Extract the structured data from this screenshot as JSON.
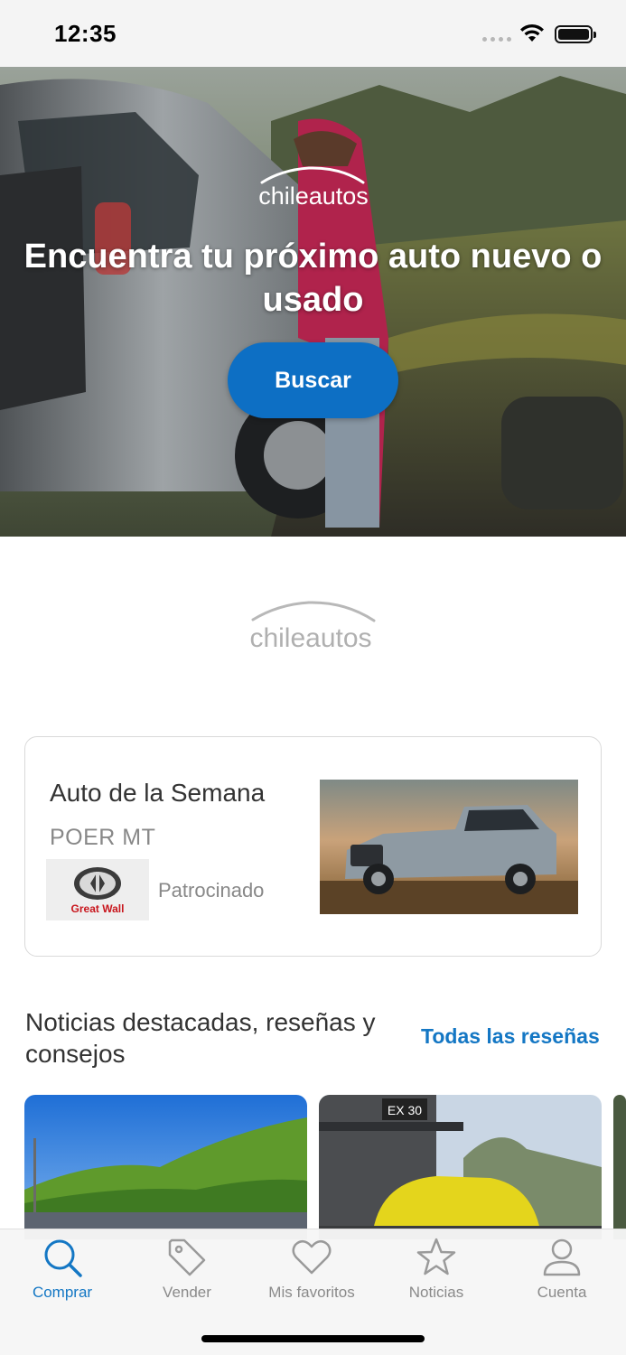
{
  "status_bar": {
    "time": "12:35"
  },
  "hero": {
    "logo_text": "chileautos",
    "title": "Encuentra tu próximo auto nuevo o usado",
    "search_button": "Buscar"
  },
  "mid_logo_text": "chileautos",
  "week_card": {
    "title": "Auto de la Semana",
    "model": "POER MT",
    "brand": "Great Wall",
    "sponsored": "Patrocinado"
  },
  "news": {
    "title": "Noticias destacadas, reseñas y consejos",
    "all_link": "Todas las reseñas"
  },
  "tabs": [
    {
      "label": "Comprar",
      "icon": "search-icon",
      "active": true
    },
    {
      "label": "Vender",
      "icon": "tag-icon",
      "active": false
    },
    {
      "label": "Mis favoritos",
      "icon": "heart-icon",
      "active": false
    },
    {
      "label": "Noticias",
      "icon": "star-icon",
      "active": false
    },
    {
      "label": "Cuenta",
      "icon": "user-icon",
      "active": false
    }
  ],
  "colors": {
    "accent": "#1477c4",
    "button": "#0d6fc4",
    "brand_red": "#c8161d"
  }
}
